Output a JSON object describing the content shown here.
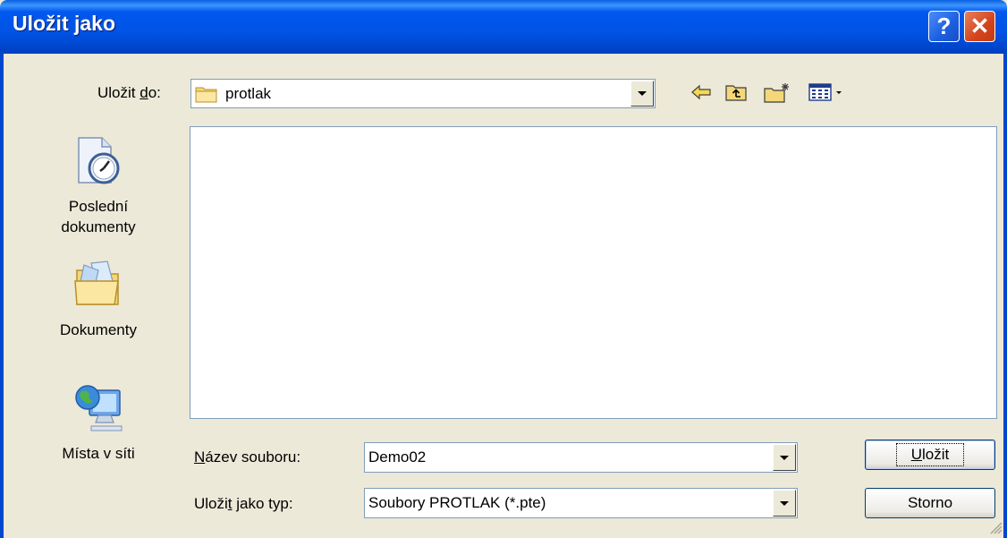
{
  "window": {
    "title": "Uložit jako",
    "help_glyph": "?",
    "close_glyph": "✕"
  },
  "save_in": {
    "label_pre": "Uložit ",
    "label_key": "d",
    "label_post": "o:",
    "value": "protlak"
  },
  "toolbar": {
    "icons": [
      "back-arrow-icon",
      "up-folder-icon",
      "new-folder-icon",
      "view-menu-icon"
    ]
  },
  "places": [
    {
      "label_line1": "Poslední",
      "label_line2": "dokumenty",
      "icon": "recent-documents-icon"
    },
    {
      "label_line1": "Dokumenty",
      "label_line2": "",
      "icon": "documents-folder-icon"
    },
    {
      "label_line1": "Místa v síti",
      "label_line2": "",
      "icon": "network-places-icon"
    }
  ],
  "file_name": {
    "label_key": "N",
    "label_post": "ázev souboru:",
    "value": "Demo02"
  },
  "file_type": {
    "label_pre": "Uloži",
    "label_key": "t",
    "label_post": " jako typ:",
    "value": "Soubory PROTLAK (*.pte)"
  },
  "buttons": {
    "save_key": "U",
    "save_post": "ložit",
    "cancel": "Storno"
  },
  "colors": {
    "titlebar": "#0053E6",
    "dialog_bg": "#ECE9D8",
    "field_border": "#7F9DB9"
  }
}
